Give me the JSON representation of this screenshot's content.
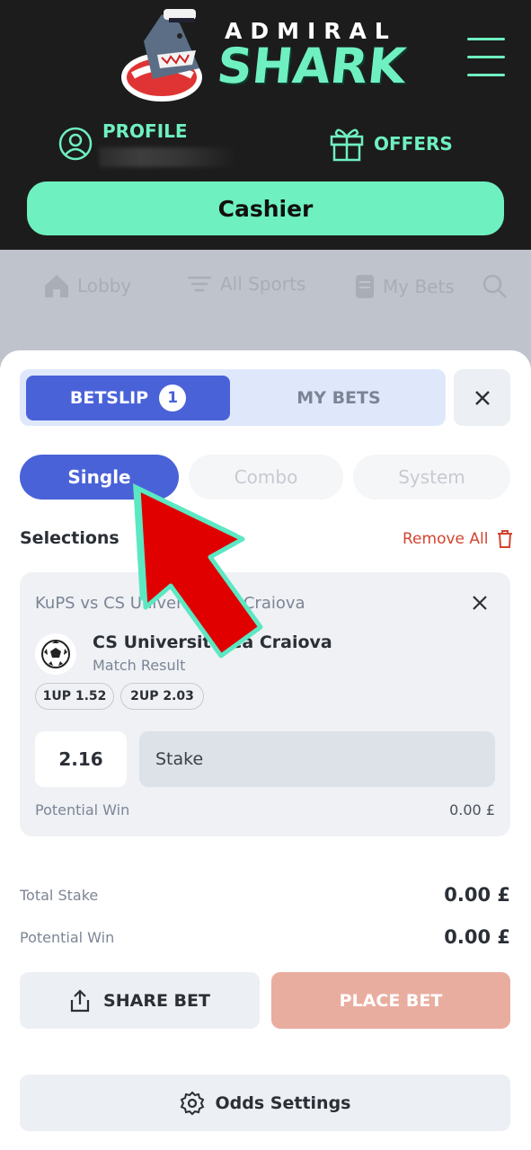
{
  "brand": {
    "top_word": "ADMIRAL",
    "main_word": "SHARK"
  },
  "header": {
    "profile_label": "PROFILE",
    "offers_label": "OFFERS",
    "cashier_label": "Cashier"
  },
  "nav": {
    "lobby": "Lobby",
    "all_sports": "All Sports",
    "my_bets": "My Bets"
  },
  "betslip": {
    "tab_betslip": "BETSLIP",
    "badge_count": "1",
    "tab_mybets": "MY BETS",
    "modes": {
      "single": "Single",
      "combo": "Combo",
      "system": "System"
    },
    "selections_title": "Selections",
    "remove_all": "Remove All",
    "selection": {
      "match": "KuPS vs CS Universitatea Craiova",
      "pick": "CS Universitatea Craiova",
      "market": "Match Result",
      "chip_1": "1UP 1.52",
      "chip_2": "2UP 2.03",
      "odds": "2.16",
      "stake_placeholder": "Stake",
      "potential_win_label": "Potential Win",
      "potential_win_value": "0.00 £"
    },
    "total_stake_label": "Total Stake",
    "total_stake_value": "0.00 £",
    "potential_win_label": "Potential Win",
    "potential_win_value": "0.00 £",
    "share_bet": "SHARE BET",
    "place_bet": "PLACE BET",
    "odds_settings": "Odds Settings"
  },
  "colors": {
    "accent": "#6ff0c0",
    "primary": "#4a62d8",
    "danger": "#d2452f",
    "annotation_arrow": "#e00000"
  }
}
